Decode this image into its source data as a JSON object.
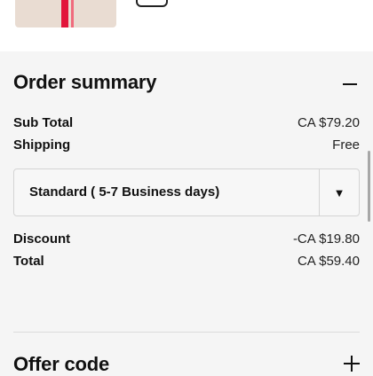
{
  "product": {
    "icon": "gift-box-thumbnail"
  },
  "order_summary": {
    "title": "Order summary",
    "toggle_icon": "minus-icon",
    "sub_total": {
      "label": "Sub Total",
      "value": "CA $79.20"
    },
    "shipping": {
      "label": "Shipping",
      "value": "Free"
    },
    "shipping_method": {
      "selected": "Standard ( 5-7 Business days)",
      "caret_icon": "caret-down-icon"
    },
    "discount": {
      "label": "Discount",
      "value": "-CA $19.80"
    },
    "total": {
      "label": "Total",
      "value": "CA $59.40"
    }
  },
  "offer_code": {
    "title": "Offer code",
    "toggle_icon": "plus-icon"
  },
  "colors": {
    "accent_ribbon": "#e2153b",
    "background": "#f5f5f5"
  }
}
